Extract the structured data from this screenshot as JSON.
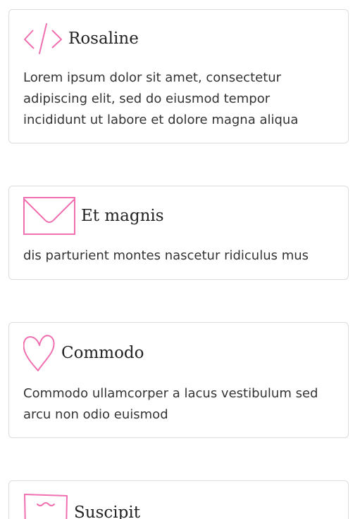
{
  "cards": [
    {
      "title": "Rosaline",
      "icon": "code-icon",
      "text": "Lorem ipsum dolor sit amet, consectetur adipiscing elit, sed do eiusmod tempor incididunt ut labore et dolore magna aliqua"
    },
    {
      "title": "Et magnis",
      "icon": "envelope-icon",
      "text": "dis parturient montes nascetur ridiculus mus"
    },
    {
      "title": "Commodo",
      "icon": "heart-icon",
      "text": "Commodo ullamcorper a lacus vestibulum sed arcu non odio euismod"
    },
    {
      "title": "Suscipit",
      "icon": "note-icon",
      "text": ""
    }
  ],
  "accent_color": "#f06fb0"
}
